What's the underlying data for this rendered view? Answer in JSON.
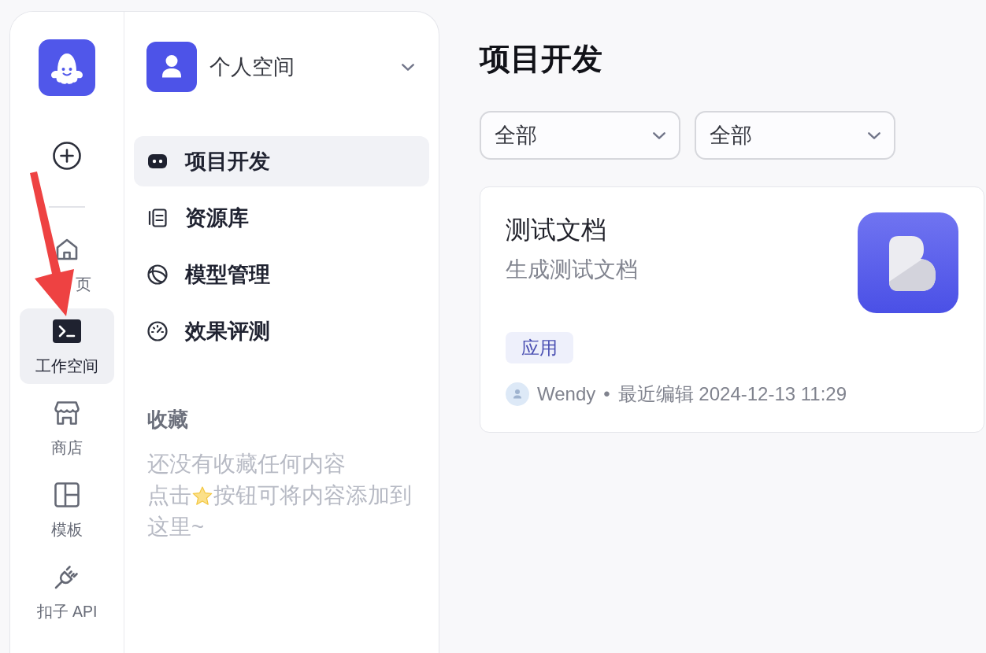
{
  "rail": {
    "items": [
      {
        "kind": "home",
        "label": "页",
        "selected": false,
        "obscured": true
      },
      {
        "kind": "workspace",
        "label": "工作空间",
        "selected": true,
        "obscured": false
      },
      {
        "kind": "store",
        "label": "商店",
        "selected": false,
        "obscured": false
      },
      {
        "kind": "template",
        "label": "模板",
        "selected": false,
        "obscured": false
      },
      {
        "kind": "api",
        "label": "扣子 API",
        "selected": false,
        "obscured": false
      }
    ]
  },
  "sidebar": {
    "workspace": {
      "name": "个人空间"
    },
    "items": [
      {
        "kind": "project",
        "label": "项目开发",
        "selected": true
      },
      {
        "kind": "library",
        "label": "资源库",
        "selected": false
      },
      {
        "kind": "model",
        "label": "模型管理",
        "selected": false
      },
      {
        "kind": "evaluation",
        "label": "效果评测",
        "selected": false
      }
    ],
    "favorites": {
      "title": "收藏",
      "empty_lines": [
        {
          "kind": "text",
          "text": "还没有收藏任何内容"
        },
        {
          "kind": "with_icon",
          "before": "点击",
          "after": "按钮可将内容添加到"
        },
        {
          "kind": "text",
          "text": "这里~"
        }
      ]
    }
  },
  "main": {
    "title": "项目开发",
    "filters": [
      {
        "value": "全部"
      },
      {
        "value": "全部"
      }
    ],
    "cards": [
      {
        "title": "测试文档",
        "description": "生成测试文档",
        "tag": "应用",
        "author": "Wendy",
        "separator": "•",
        "edited": "最近编辑 2024-12-13 11:29"
      }
    ]
  },
  "annotations": [
    {
      "kind": "arrow"
    }
  ]
}
